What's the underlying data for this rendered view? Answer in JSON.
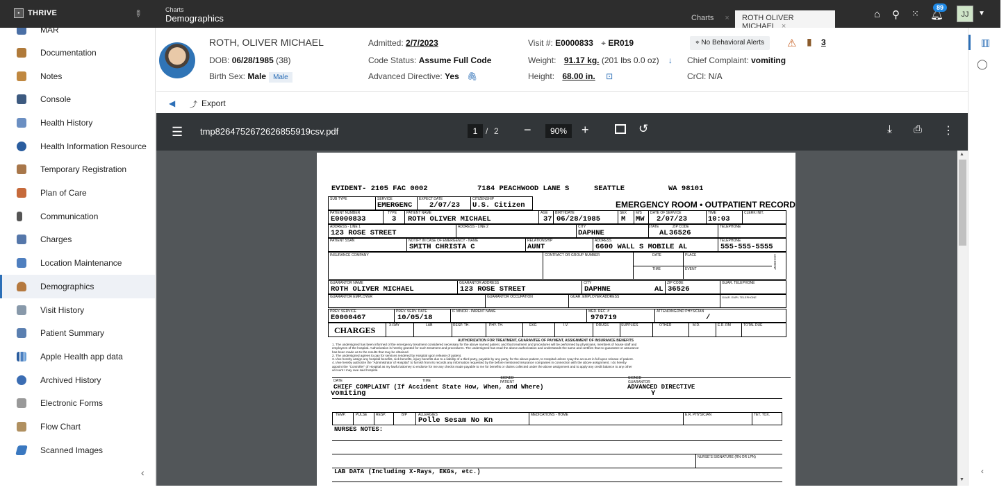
{
  "topbar": {
    "brand": "THRIVE",
    "crumb_small": "Charts",
    "crumb_big": "Demographics",
    "tabs": [
      {
        "label": "Charts"
      },
      {
        "label": "ROTH OLIVER MICHAEL"
      }
    ],
    "close_glyph": "×",
    "notif_count": "89",
    "user_initials": "JJ"
  },
  "sidebar": {
    "items": [
      {
        "label": "MAR",
        "icon": "mar-icon"
      },
      {
        "label": "Documentation",
        "icon": "documentation-icon"
      },
      {
        "label": "Notes",
        "icon": "notes-icon"
      },
      {
        "label": "Console",
        "icon": "console-icon"
      },
      {
        "label": "Health History",
        "icon": "health-history-icon"
      },
      {
        "label": "Health Information Resource",
        "icon": "globe-icon"
      },
      {
        "label": "Temporary Registration",
        "icon": "temp-registration-icon"
      },
      {
        "label": "Plan of Care",
        "icon": "plan-of-care-icon"
      },
      {
        "label": "Communication",
        "icon": "phone-icon"
      },
      {
        "label": "Charges",
        "icon": "charges-icon"
      },
      {
        "label": "Location Maintenance",
        "icon": "location-icon"
      },
      {
        "label": "Demographics",
        "icon": "person-icon"
      },
      {
        "label": "Visit History",
        "icon": "visit-history-icon"
      },
      {
        "label": "Patient Summary",
        "icon": "patient-summary-icon"
      },
      {
        "label": "Apple Health app data",
        "icon": "bar-chart-icon"
      },
      {
        "label": "Archived History",
        "icon": "archive-icon"
      },
      {
        "label": "Electronic Forms",
        "icon": "forms-icon"
      },
      {
        "label": "Flow Chart",
        "icon": "flow-chart-icon"
      },
      {
        "label": "Scanned Images",
        "icon": "scanner-icon"
      }
    ],
    "active": "Demographics",
    "collapse_glyph": "‹"
  },
  "patient": {
    "last": "ROTH",
    "rest": ", OLIVER MICHAEL",
    "dob_label": "DOB:",
    "dob": "06/28/1985",
    "age": "(38)",
    "sex_label": "Birth Sex:",
    "sex": "Male",
    "sex_tag": "Male",
    "admitted_label": "Admitted:",
    "admitted": "2/7/2023",
    "code_label": "Code Status:",
    "code": "Assume Full Code",
    "adv_label": "Advanced Directive:",
    "adv": "Yes",
    "visit_label": "Visit #:",
    "visit": "E0000833",
    "location": "ER019",
    "weight_label": "Weight:",
    "weight": "91.17 kg.",
    "weight_alt": "(201 lbs 0.0 oz)",
    "height_label": "Height:",
    "height": "68.00 in.",
    "alerts": "No Behavioral Alerts",
    "alert_count": "3",
    "complaint_label": "Chief Complaint:",
    "complaint": "vomiting",
    "crcl_label": "CrCl:",
    "crcl": "N/A"
  },
  "toolbar": {
    "export_label": "Export"
  },
  "pdf": {
    "filename": "tmp8264752672626855919csv.pdf",
    "page": "1",
    "page_sep": "/",
    "total_pages": "2",
    "zoom": "90%"
  },
  "form": {
    "line1": "EVIDENT- 2105 FAC 0002",
    "line1_addr": "7184 PEACHWOOD LANE S",
    "line1_city": "SEATTLE",
    "line1_state": "WA 98101",
    "title": "EMERGENCY ROOM • OUTPATIENT RECORD",
    "labels": {
      "sub_type": "SUB TYPE",
      "service": "SERVICE",
      "expect_date": "EXPECT DATE",
      "citizenship": "CITIZENSHIP",
      "patient_number": "PATIENT NUMBER",
      "type": "TYPE",
      "patient_name": "PATIENT NAME",
      "age": "AGE",
      "birthdate": "BIRTHDATE",
      "sex": "SEX",
      "ms": "M/S",
      "date_of_service": "DATE OF SERVICE",
      "time": "TIME",
      "clerk_init": "CLERK INIT.",
      "addr1": "ADDRESS - LINE 1",
      "addr2": "ADDRESS - LINE 2",
      "city": "CITY",
      "state": "STATE",
      "zip": "ZIP CODE",
      "telephone": "TELEPHONE",
      "patient_ssan": "PATIENT SSAN",
      "notify": "NOTIFY IN CASE OF EMERGENCY - NAME",
      "relationship": "RELATIONSHIP",
      "address": "ADDRESS",
      "insurance": "INSURANCE COMPANY",
      "contract": "CONTRACT OR GROUP NUMBER",
      "date": "DATE",
      "place": "PLACE",
      "event": "EVENT",
      "accident": "ACCIDENT",
      "guarantor_name": "GUARANTOR NAME",
      "guarantor_address": "GUARANTOR ADDRESS",
      "guar_telephone": "GUAR. TELEPHONE",
      "guarantor_employer": "GUARANTOR EMPLOYER",
      "guarantor_occupation": "GUARANTOR OCCUPATION",
      "guar_employer_address": "GUAR. EMPLOYER ADDRESS",
      "guar_empl_telephone": "GUAR. EMPL TELEPHONE",
      "prev_service": "PREV. SERVICE",
      "prev_serv_date": "PREV. SERV. DATE",
      "if_minor": "IF MINOR - PARENT NAME",
      "med_rec": "MED. REC. #",
      "attending": "ATTENDING/2ND PHYSICIAN",
      "xray": "X-RAY",
      "lab": "LAB",
      "resp_th": "RESP. TH.",
      "phy_th": "PHY. TH.",
      "ekg": "EKG",
      "iv": "I.V.",
      "drugs": "DRUGS",
      "supplies": "SUPPLIES",
      "other": "OTHER",
      "md": "M.D.",
      "er_rm": "E.R. RM",
      "total_due": "TOTAL DUE",
      "authorization": "AUTHORIZATION FOR TREATMENT, GUARANTEE OF PAYMENT, ASSIGNMENT OF INSURANCE BENEFITS",
      "date_bottom": "DATE",
      "time_bottom": "TIME",
      "signed_patient": "SIGNED PATIENT",
      "signed_guarantor": "SIGNED GUARANTOR",
      "chief_complaint": "CHIEF COMPLAINT (If Accident State How, When, and Where)",
      "adv_directive": "ADVANCED DIRECTIVE",
      "temp": "TEMP.",
      "pulse": "PULSE",
      "resp": "RESP.",
      "bp": "B/P",
      "allergies": "ALLERGIES",
      "medications": "MEDICATIONS - HOME",
      "er_physician": "E.R. PHYSICIAN",
      "tet_tox": "TET. TOX.",
      "nurses_notes": "NURSES NOTES:",
      "nurse_signature": "NURSE'S SIGNATURE (RN OR LPN)",
      "lab_data": "LAB DATA (Including X-Rays, EKGs, etc.)",
      "charges": "CHARGES"
    },
    "values": {
      "service": "EMERGENC",
      "expect_date": "2/07/23",
      "citizenship": "U.S. Citizen",
      "patient_number": "E0000833",
      "type": "3",
      "patient_name": "ROTH OLIVER MICHAEL",
      "age": "37",
      "birthdate": "06/28/1985",
      "sex": "M",
      "ms": "MW",
      "date_of_service": "2/07/23",
      "time": "10:03",
      "addr1": "123 ROSE STREET",
      "city": "DAPHNE",
      "state": "AL",
      "zip": "36526",
      "notify": "SMITH CHRISTA C",
      "relationship": "AUNT",
      "address": "6600 WALL S MOBILE  AL",
      "telephone": "555-555-5555",
      "guarantor_name": "ROTH OLIVER MICHAEL",
      "guarantor_address": "123 ROSE STREET",
      "guar_city": "DAPHNE",
      "guar_state": "AL",
      "guar_zip": "36526",
      "prev_service": "E0000467",
      "prev_serv_date": "10/05/18",
      "med_rec": "970719",
      "attending": "/",
      "chief_complaint": "vomiting",
      "adv_directive": "Y",
      "allergies": "Polle Sesam No Kn"
    },
    "fine_print": [
      "1.   The undersigned has been informed of the emergency treatment considered necessary for the above named patient, and that treatment and procedures will be performed by physicians, members of house staff and",
      "      employees of the hospital. Authorization is hereby granted for such treatment and procedures. The undersigned has read the above authorization and understands the same and certifies that no guarantee or assurance",
      "      has been made as to the results that may be obtained.",
      "2.   The undersigned agrees to pay for services rendered by Hospital upon release of patient.",
      "3.   I/we hereby assign any hospital benefits, sick benefits, injury benefits due to a liability of a third party, payable by any party, for the above patient, to Hospital unless I pay the account in full upon release of patient.",
      "4.   I/we hereby authorize the \"Administrator of Hospital\" to furnish from its records any information requested by the before mentioned insurance companies in connection with the above assignment. I do hereby",
      "      appoint the \"Controller\" of Hospital as my lawful attorney to endorse for me any checks made payable to me for benefits or claims collected under the above assignment and to apply any credit balance to any other",
      "      account I may owe said hospital."
    ]
  }
}
